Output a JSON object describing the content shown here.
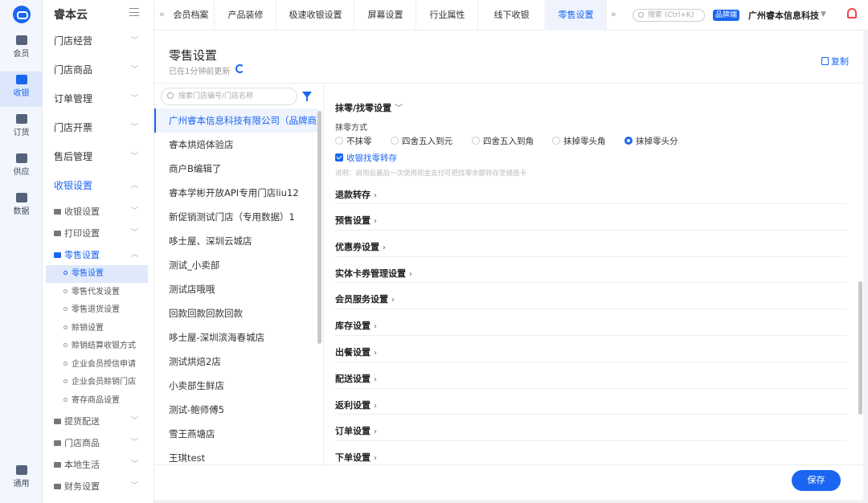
{
  "rail": {
    "items": [
      {
        "label": "会员",
        "icon": "member-card-icon"
      },
      {
        "label": "收银",
        "icon": "cashier-monitor-icon",
        "active": true
      },
      {
        "label": "订货",
        "icon": "order-doc-icon"
      },
      {
        "label": "供应",
        "icon": "truck-icon"
      },
      {
        "label": "数据",
        "icon": "chart-icon"
      },
      {
        "label": "通用",
        "icon": "share-nodes-icon"
      }
    ]
  },
  "menu": {
    "brand": "睿本云",
    "top": [
      "门店经营",
      "门店商品",
      "订单管理",
      "门店开票",
      "售后管理",
      "收银设置"
    ],
    "sub_cashier": [
      "收银设置",
      "打印设置",
      "零售设置"
    ],
    "retail_children": [
      "零售设置",
      "零售代发设置",
      "零售退货设置",
      "赊销设置",
      "赊销结算收银方式",
      "企业会员授信申请",
      "企业会员赊销门店",
      "寄存商品设置"
    ],
    "after": [
      "提货配送",
      "门店商品",
      "本地生活",
      "财务设置"
    ]
  },
  "tabs": [
    "会员档案",
    "产品装修",
    "极速收银设置",
    "屏幕设置",
    "行业属性",
    "线下收银",
    "零售设置"
  ],
  "topbar": {
    "search_placeholder": "搜索 (Ctrl+K)",
    "badge": "品牌端",
    "company": "广州睿本信息科技"
  },
  "page": {
    "title": "零售设置",
    "updated": "已在1分钟前更新",
    "copy_label": "复制"
  },
  "store_search_placeholder": "搜索门店编号/门店名称",
  "stores": [
    "广州睿本信息科技有限公司（品牌商）",
    "睿本烘焙体验店",
    "商户B编辑了",
    "睿本学彬开放API专用门店liu12",
    "新促销测试门店（专用数据）1",
    "哆士屋、深圳云城店",
    "测试_小卖部",
    "测试店哦哦",
    "回款回款回款回款",
    "哆士屋-深圳滨海春城店",
    "测试烘焙2店",
    "小卖部生鲜店",
    "测试-鲍师傅5",
    "雪王燕塘店",
    "王琪test"
  ],
  "settings": {
    "rounding_title": "抹零/找零设置",
    "rounding_method_label": "抹零方式",
    "rounding_options": [
      "不抹零",
      "四舍五入到元",
      "四舍五入到角",
      "抹掉零头角",
      "抹掉零头分"
    ],
    "rounding_selected_index": 4,
    "change_to_savings": "收银找零转存",
    "change_note": "说明：启用后最后一次使用现金支付可把找零余额转存至储值卡",
    "sections": [
      "退款转存",
      "预售设置",
      "优惠券设置",
      "实体卡券管理设置",
      "会员服务设置",
      "库存设置",
      "出餐设置",
      "配送设置",
      "返利设置",
      "订单设置",
      "下单设置"
    ]
  },
  "save_label": "保存"
}
